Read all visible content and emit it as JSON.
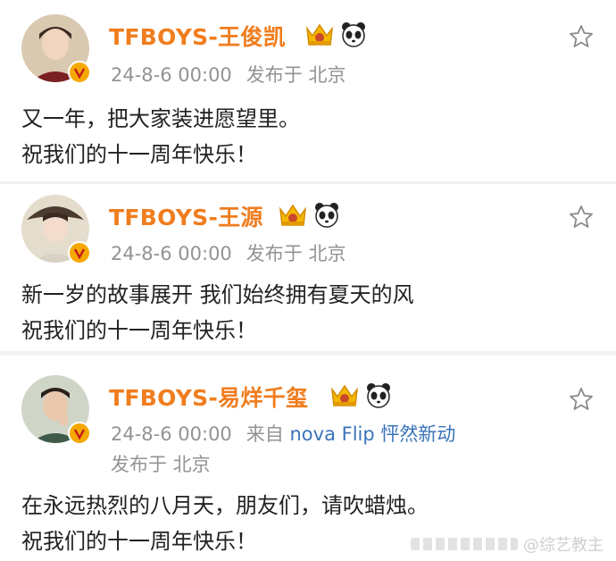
{
  "posts": [
    {
      "username": "TFBOYS-王俊凯",
      "time": "24-8-6 00:00",
      "location": "发布于 北京",
      "source": "",
      "content_lines": [
        "又一年，把大家装进愿望里。",
        "祝我们的十一周年快乐！"
      ]
    },
    {
      "username": "TFBOYS-王源",
      "time": "24-8-6 00:00",
      "location": "发布于 北京",
      "source": "",
      "content_lines": [
        "新一岁的故事展开 我们始终拥有夏天的风",
        "祝我们的十一周年快乐！"
      ]
    },
    {
      "username": "TFBOYS-易烊千玺",
      "time": "24-8-6 00:00",
      "source_prefix": "来自",
      "source": "nova Flip 怦然新动",
      "location": "发布于 北京",
      "content_lines": [
        "在永远热烈的八月天，朋友们，请吹蜡烛。",
        "祝我们的十一周年快乐！"
      ]
    }
  ],
  "watermark": "@综艺教主",
  "icons": {
    "crown_badge": "crown-vip-icon",
    "panda_badge": "panda-icon",
    "verified": "verified-v-icon",
    "favorite": "star-outline-icon"
  },
  "colors": {
    "username": "#f07d1e",
    "meta": "#939393",
    "source_link": "#3b73b9",
    "content": "#222222",
    "verified": "#f5a800",
    "separator": "#f2f2f2"
  }
}
